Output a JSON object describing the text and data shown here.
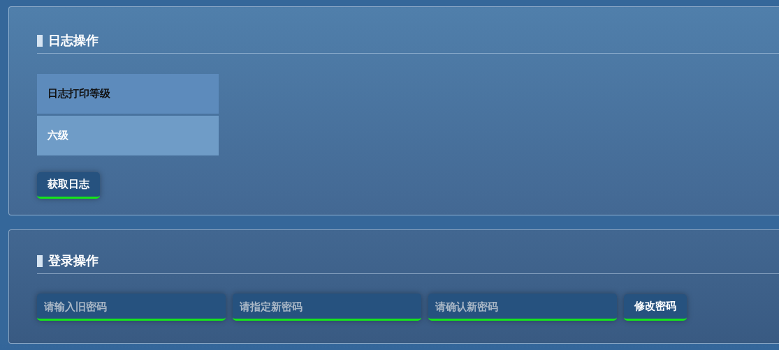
{
  "log_panel": {
    "title": "日志操作",
    "table": [
      {
        "kind": "header",
        "text": "日志打印等级"
      },
      {
        "kind": "value",
        "text": "六级"
      }
    ],
    "button": "获取日志"
  },
  "login_panel": {
    "title": "登录操作",
    "fields": [
      {
        "placeholder": "请输入旧密码"
      },
      {
        "placeholder": "请指定新密码"
      },
      {
        "placeholder": "请确认新密码"
      }
    ],
    "button": "修改密码"
  }
}
